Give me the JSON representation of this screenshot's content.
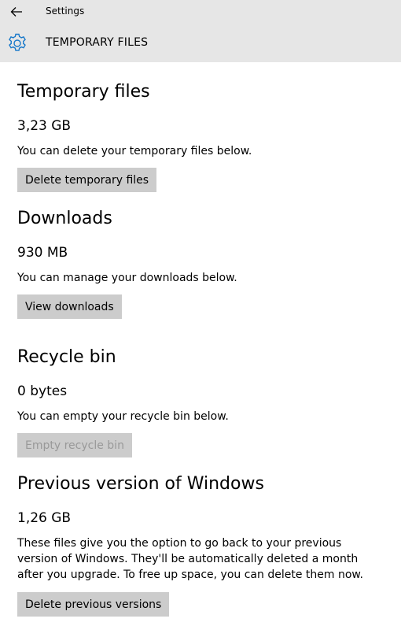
{
  "header": {
    "window_title": "Settings",
    "page_title": "TEMPORARY FILES"
  },
  "sections": [
    {
      "heading": "Temporary files",
      "size": "3,23 GB",
      "description": "You can delete your temporary files below.",
      "button_label": "Delete temporary files",
      "button_enabled": true
    },
    {
      "heading": "Downloads",
      "size": "930 MB",
      "description": "You can manage your downloads below.",
      "button_label": "View downloads",
      "button_enabled": true
    },
    {
      "heading": "Recycle bin",
      "size": "0 bytes",
      "description": "You can empty your recycle bin below.",
      "button_label": "Empty recycle bin",
      "button_enabled": false
    },
    {
      "heading": "Previous version of Windows",
      "size": "1,26 GB",
      "description": "These files give you the option to go back to your previous version of Windows. They'll be automatically deleted a month after you upgrade. To free up space, you can delete them now.",
      "button_label": "Delete previous versions",
      "button_enabled": true
    }
  ],
  "colors": {
    "header_bg": "#e6e6e6",
    "accent": "#1979ca",
    "button_bg": "#cccccc",
    "disabled_text": "#999999"
  },
  "icons": {
    "back": "back-arrow-icon",
    "page": "gear-icon"
  }
}
